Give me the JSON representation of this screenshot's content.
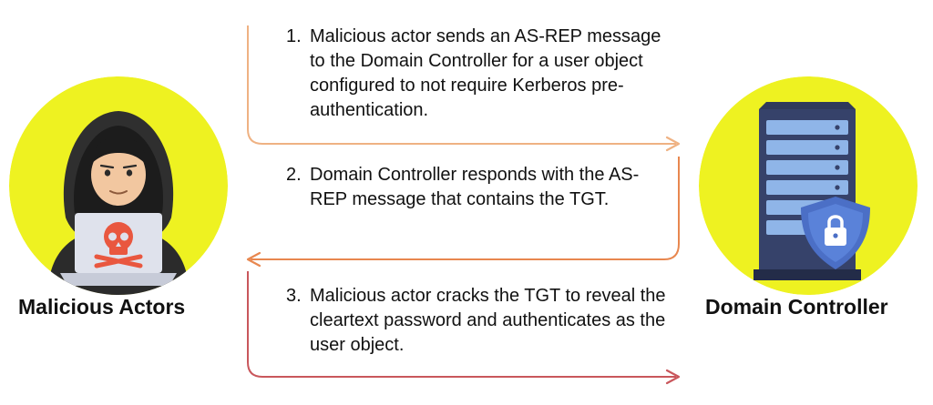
{
  "actors": {
    "left": {
      "label": "Malicious Actors",
      "icon": "hooded-hacker-laptop-icon",
      "circle_color": "#eef221"
    },
    "right": {
      "label": "Domain Controller",
      "icon": "server-shield-lock-icon",
      "circle_color": "#eef221"
    }
  },
  "steps": [
    {
      "number": "1.",
      "text": "Malicious actor sends an AS-REP message to the Domain Controller for a user object configured to not require Kerberos pre-authentication.",
      "direction": "left-to-right",
      "arrow_color": "#efb283"
    },
    {
      "number": "2.",
      "text": "Domain Controller responds with the AS-REP message that contains the TGT.",
      "direction": "right-to-left",
      "arrow_color": "#e8874f"
    },
    {
      "number": "3.",
      "text": "Malicious actor cracks the TGT to reveal the cleartext password and authenticates as the user object.",
      "direction": "left-to-right",
      "arrow_color": "#c9575c"
    }
  ]
}
